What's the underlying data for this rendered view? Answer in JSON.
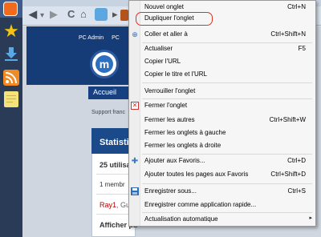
{
  "menu": {
    "items": [
      {
        "label": "Nouvel onglet",
        "shortcut": "Ctrl+N"
      },
      {
        "label": "Dupliquer l'onglet",
        "shortcut": ""
      },
      {
        "label": "Coller et aller à",
        "shortcut": "Ctrl+Shift+N"
      },
      {
        "label": "Actualiser",
        "shortcut": "F5"
      },
      {
        "label": "Copier l'URL",
        "shortcut": ""
      },
      {
        "label": "Copier le titre et l'URL",
        "shortcut": ""
      },
      {
        "label": "Verrouiller l'onglet",
        "shortcut": ""
      },
      {
        "label": "Fermer l'onglet",
        "shortcut": ""
      },
      {
        "label": "Fermer les autres",
        "shortcut": "Ctrl+Shift+W"
      },
      {
        "label": "Fermer les onglets à gauche",
        "shortcut": ""
      },
      {
        "label": "Fermer les onglets à droite",
        "shortcut": ""
      },
      {
        "label": "Ajouter aux Favoris...",
        "shortcut": "Ctrl+D"
      },
      {
        "label": "Ajouter toutes les pages aux Favoris",
        "shortcut": "Ctrl+Shift+D"
      },
      {
        "label": "Enregistrer sous...",
        "shortcut": "Ctrl+S"
      },
      {
        "label": "Enregistrer comme application rapide...",
        "shortcut": ""
      },
      {
        "label": "Actualisation automatique",
        "shortcut": ""
      }
    ],
    "highlighted": "Dupliquer l'onglet",
    "highlight_color": "#e03025"
  },
  "page": {
    "user": "PC Admin",
    "user_suffix": "PC",
    "logo_letter": "m",
    "nav_item": "Accueil",
    "support": "Support franc",
    "panel_title": "Statisti",
    "users_line": "25 utilisa",
    "members_line": "1 membr",
    "ray_name": "Ray1",
    "ray_suffix": ", Gu",
    "afficher": "Afficher pa"
  },
  "colors": {
    "brand_dark_blue": "#163c78",
    "sidebar": "#2a3b57",
    "menu_bg": "#f6f6f6"
  }
}
